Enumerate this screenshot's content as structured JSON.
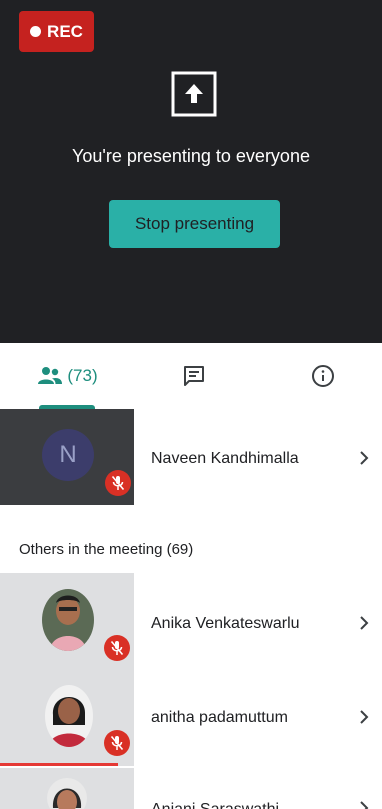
{
  "recording": {
    "label": "REC"
  },
  "presenting": {
    "message": "You're presenting to everyone",
    "stop_label": "Stop presenting"
  },
  "tabs": {
    "people_count": "(73)"
  },
  "pinned": {
    "initial": "N",
    "name": "Naveen Kandhimalla"
  },
  "others": {
    "title": "Others in the meeting (69)",
    "participants": [
      {
        "name": "Anika Venkateswarlu"
      },
      {
        "name": "anitha padamuttum"
      },
      {
        "name": "Anjani Saraswathi"
      }
    ]
  },
  "colors": {
    "accent": "#1e8e7e",
    "button": "#2ab0a7",
    "rec": "#c5221f",
    "mic_off": "#d93025"
  },
  "video_progress": 0.31
}
